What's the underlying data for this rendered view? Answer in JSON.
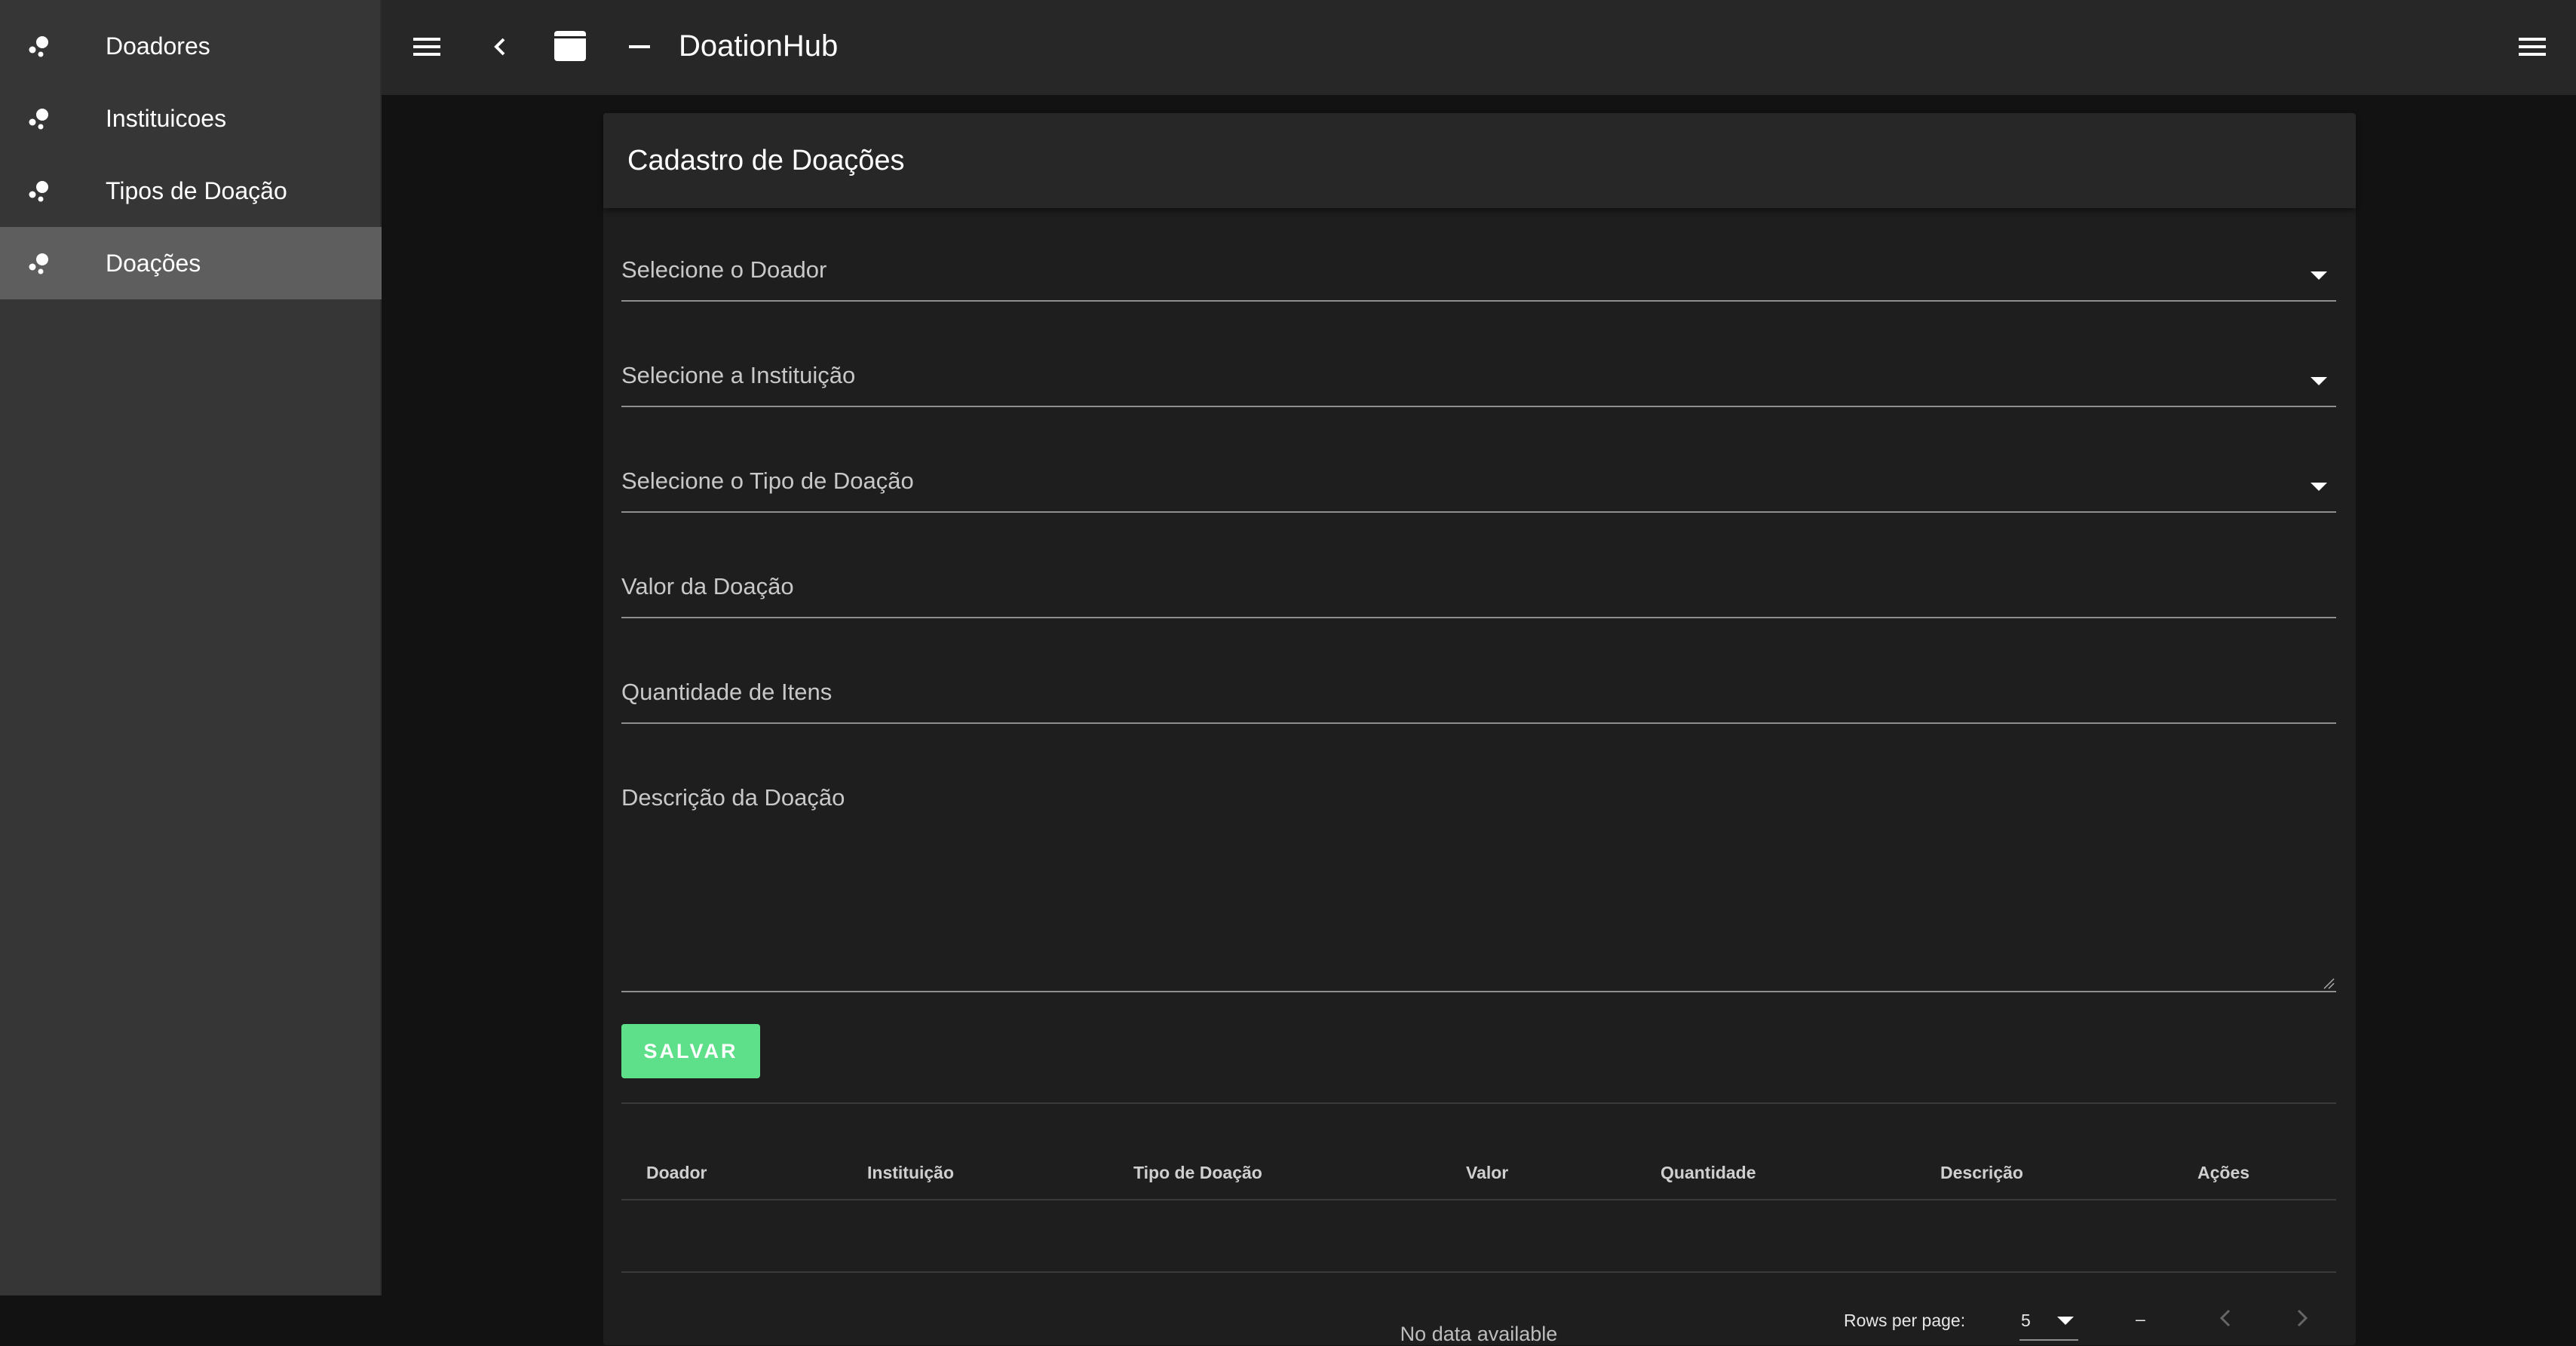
{
  "app": {
    "title": "DoationHub"
  },
  "sidebar": {
    "items": [
      {
        "label": "Doadores",
        "active": false
      },
      {
        "label": "Instituicoes",
        "active": false
      },
      {
        "label": "Tipos de Doação",
        "active": false
      },
      {
        "label": "Doações",
        "active": true
      }
    ]
  },
  "appbar": {
    "icons": [
      "menu-icon",
      "chevron-left-icon",
      "window-icon",
      "minimize-icon",
      "menu-icon"
    ]
  },
  "form": {
    "title": "Cadastro de Doações",
    "doador_label": "Selecione o Doador",
    "instituicao_label": "Selecione a Instituição",
    "tipo_label": "Selecione o Tipo de Doação",
    "valor_label": "Valor da Doação",
    "quantidade_label": "Quantidade de Itens",
    "descricao_label": "Descrição da Doação",
    "save_label": "SALVAR"
  },
  "table": {
    "headers": [
      "Doador",
      "Instituição",
      "Tipo de Doação",
      "Valor",
      "Quantidade",
      "Descrição",
      "Ações"
    ],
    "empty_text": "No data available"
  },
  "pagination": {
    "rows_per_page_label": "Rows per page:",
    "rows_per_page_value": "5",
    "range_text": "–"
  },
  "colors": {
    "accent": "#5ee08a",
    "sidebar_bg": "#363636",
    "sidebar_active": "#5e5e5e",
    "appbar_bg": "#272727",
    "card_bg": "#1e1e1e",
    "page_bg": "#121212"
  }
}
